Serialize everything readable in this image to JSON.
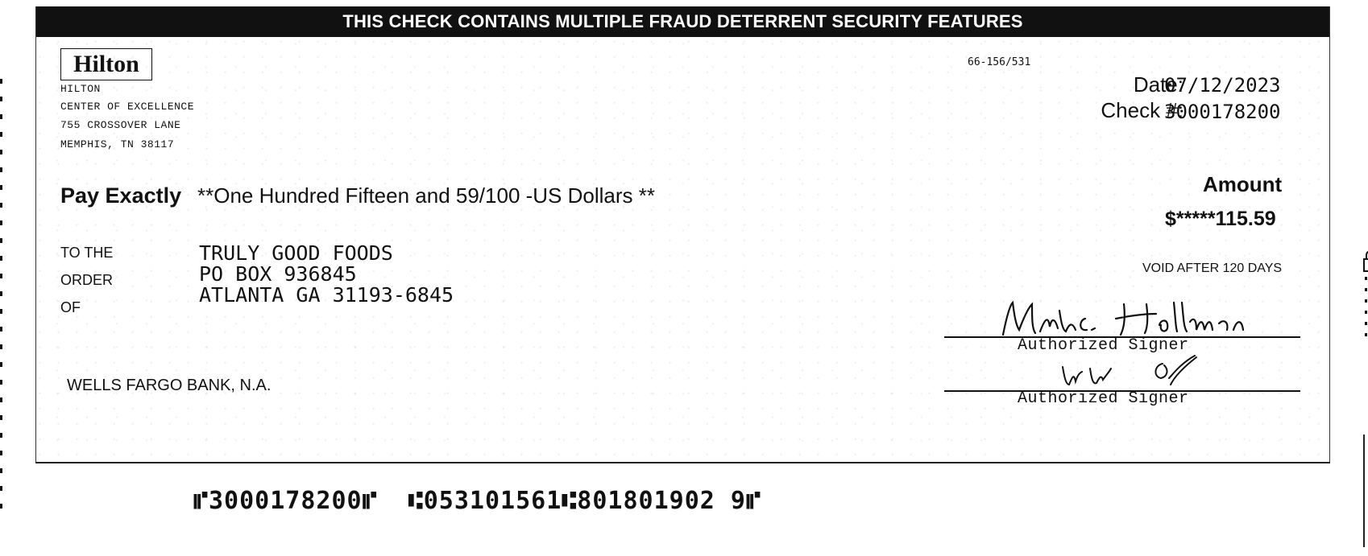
{
  "banner": "THIS CHECK CONTAINS MULTIPLE FRAUD DETERRENT SECURITY FEATURES",
  "payer": {
    "logo_text": "Hilton",
    "name": "HILTON",
    "address_lines": [
      "CENTER OF EXCELLENCE",
      "755 CROSSOVER LANE",
      "MEMPHIS, TN  38117"
    ]
  },
  "routing_fraction": "66-156/531",
  "date_label": "Date:",
  "date_value": "07/12/2023",
  "check_no_label": "Check #:",
  "check_no_value": "3000178200",
  "pay_label": "Pay Exactly",
  "amount_words": "**One Hundred Fifteen and 59/100 -US Dollars **",
  "amount_label": "Amount",
  "amount_value": "$*****115.59",
  "void_note": "VOID AFTER 120 DAYS",
  "to_the_order_of": [
    "TO THE",
    "ORDER",
    "OF"
  ],
  "payee_lines": [
    "TRULY GOOD FOODS",
    "PO BOX 936845",
    "ATLANTA GA   31193-6845"
  ],
  "bank_name": "WELLS FARGO BANK, N.A.",
  "signer_caption_1": "Authorized Signer",
  "signer_caption_2": "Authorized Signer",
  "micr_line": "⑈3000178200⑈  ⑆053101561⑆801801902 9⑈"
}
